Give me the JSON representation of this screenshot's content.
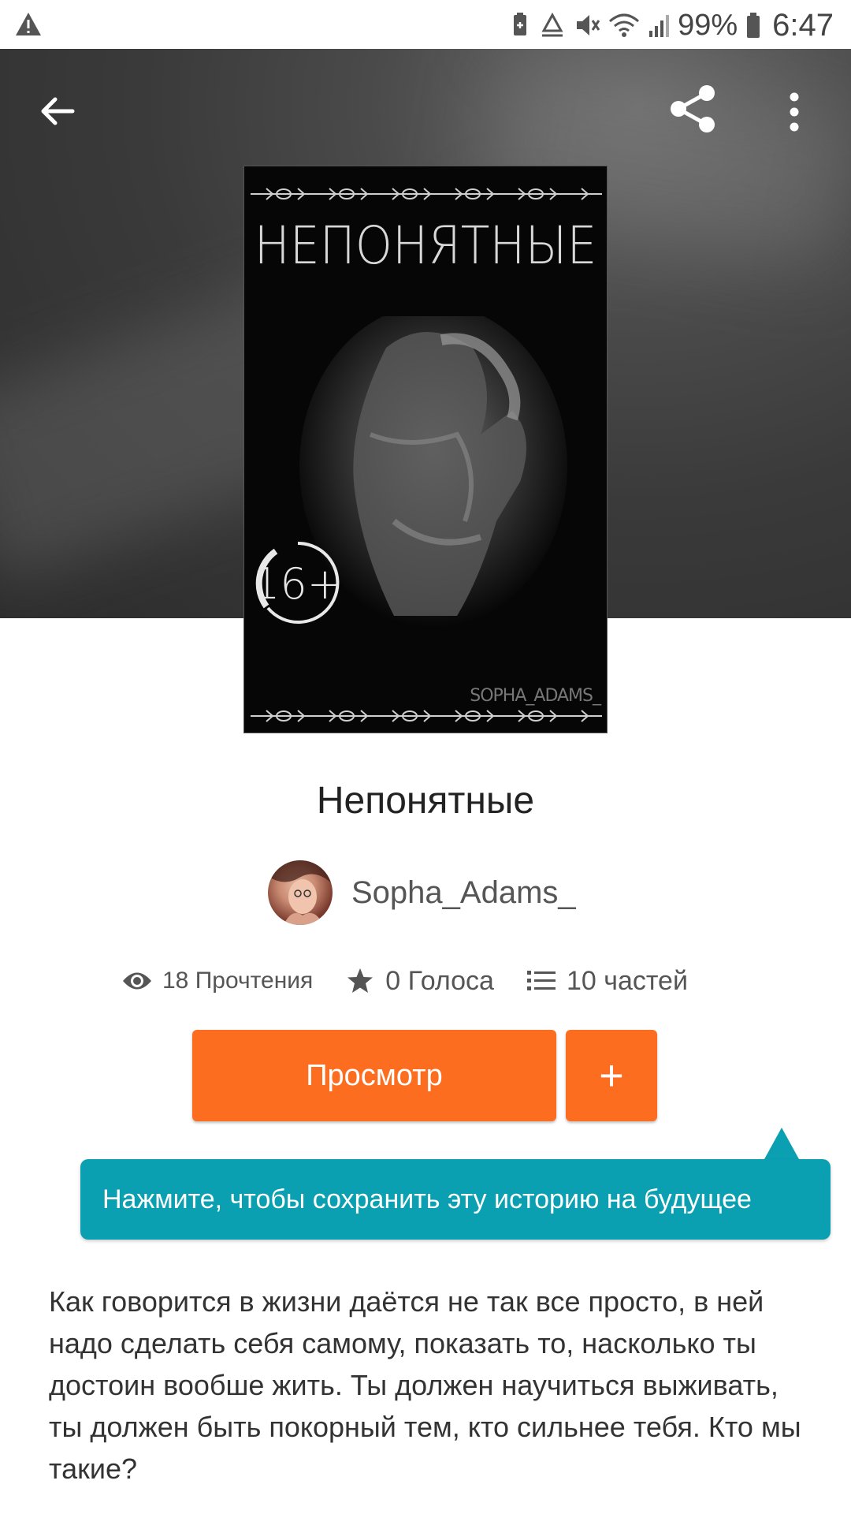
{
  "status_bar": {
    "battery_percent": "99%",
    "time": "6:47",
    "icons": [
      "warning-icon",
      "battery-saver-icon",
      "recycle-icon",
      "mute-icon",
      "wifi-icon",
      "signal-icon",
      "battery-icon"
    ]
  },
  "header": {
    "back_icon": "arrow-left-icon",
    "share_icon": "share-icon",
    "more_icon": "more-vert-icon"
  },
  "cover": {
    "title": "НЕПОНЯТНЫЕ",
    "age_rating": "16+",
    "author_signature": "SOPHA_ADAMS_"
  },
  "story": {
    "title": "Непонятные",
    "author": "Sopha_Adams_",
    "stats": {
      "reads": "18 Прочтения",
      "votes": "0 Голоса",
      "parts": "10 частей"
    },
    "view_button": "Просмотр",
    "add_button": "+",
    "tooltip": "Нажмите, чтобы сохранить эту историю на будущее",
    "description": "Как говорится в жизни даётся не так все просто, в ней надо сделать себя самому, показать то, насколько ты достоин вообше жить. Ты должен научиться выживать, ты должен быть покорный тем, кто сильнее тебя. Кто мы такие?"
  },
  "colors": {
    "accent": "#fd6d20",
    "tooltip": "#0aa0b2"
  }
}
